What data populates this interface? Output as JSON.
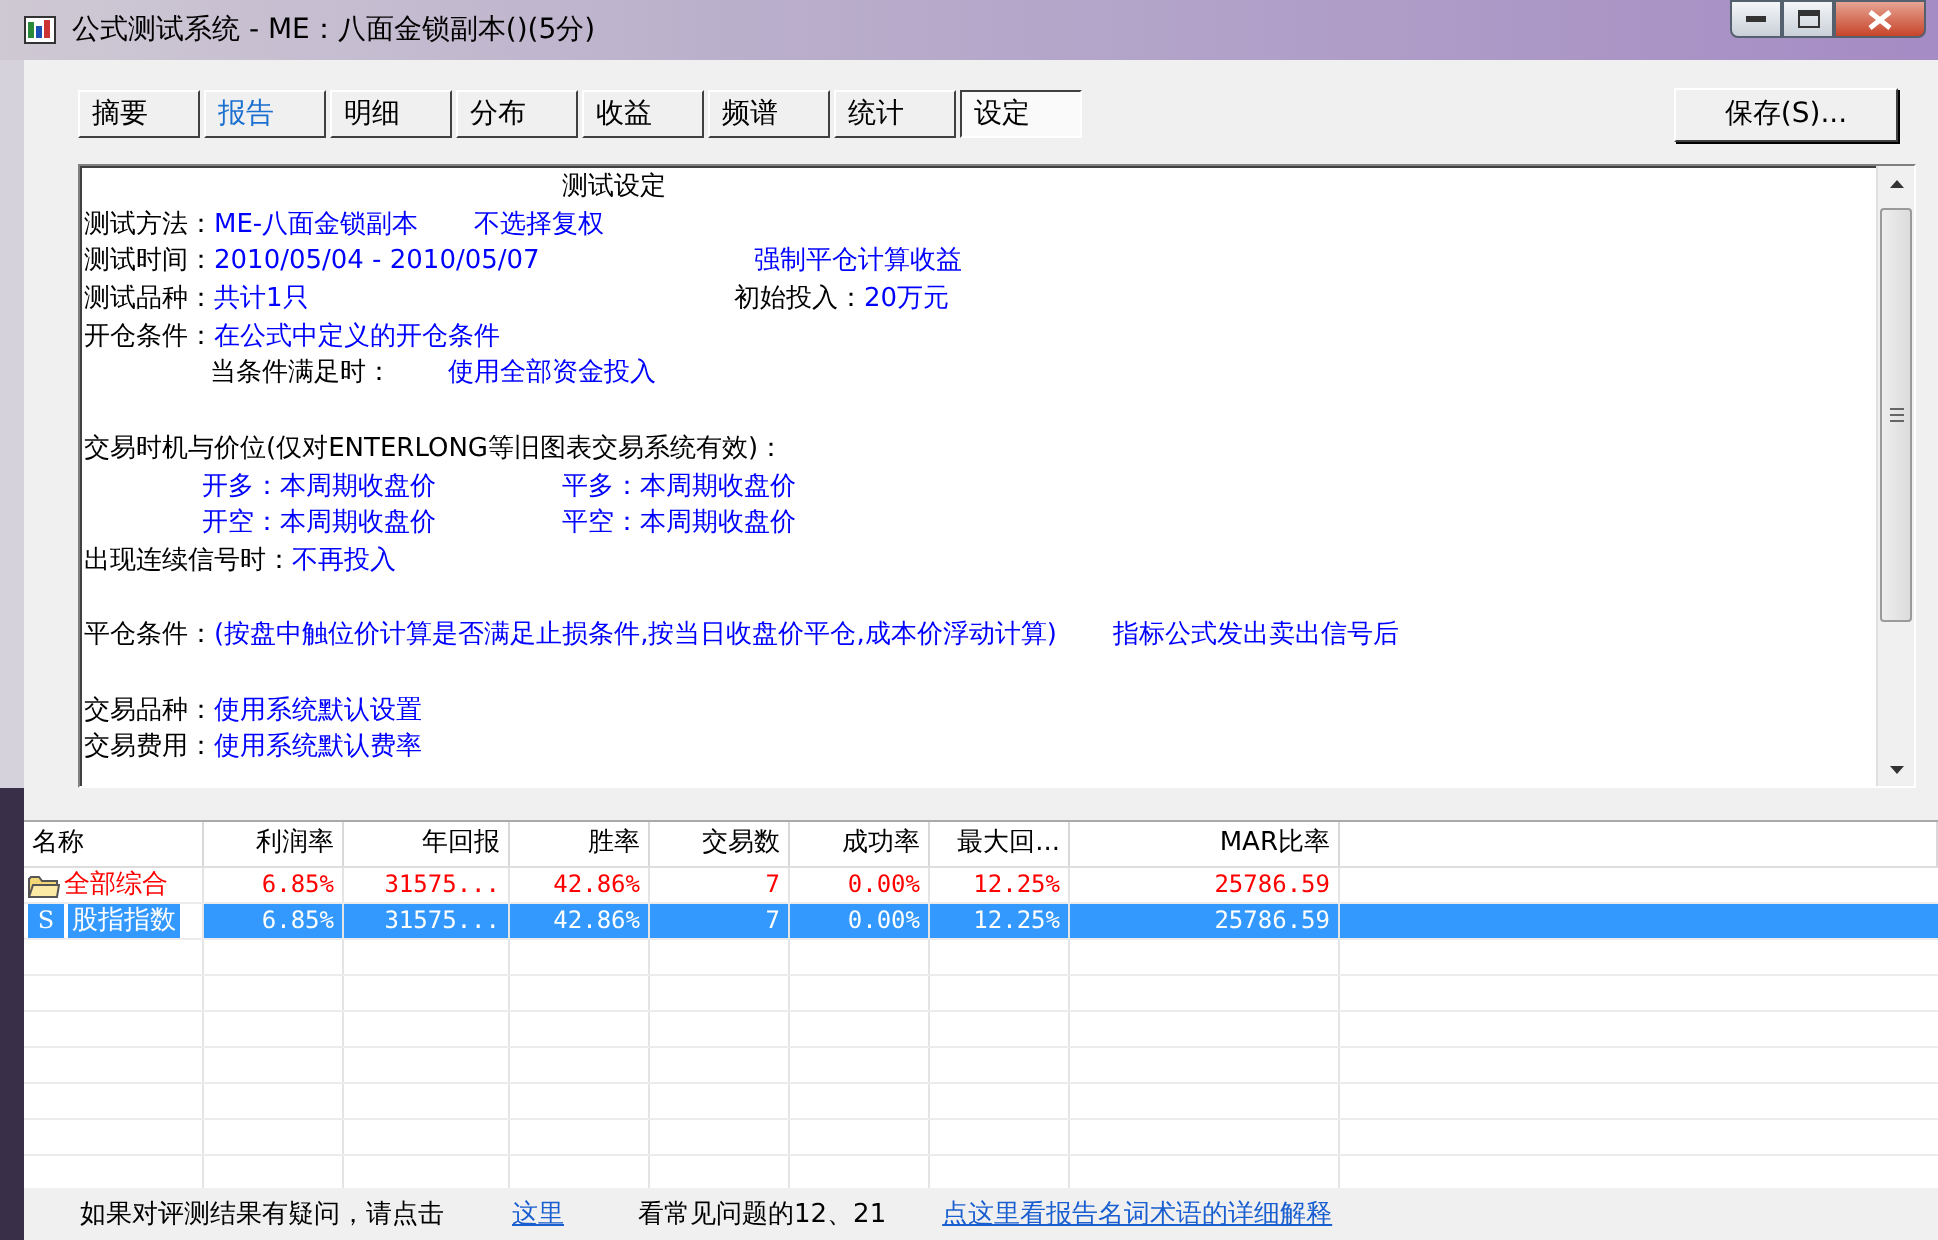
{
  "window": {
    "title": "公式测试系统 - ME：八面金锁副本()(5分)"
  },
  "tabs": [
    {
      "label": "摘要",
      "selected": false,
      "hot": false
    },
    {
      "label": "报告",
      "selected": false,
      "hot": true
    },
    {
      "label": "明细",
      "selected": false,
      "hot": false
    },
    {
      "label": "分布",
      "selected": false,
      "hot": false
    },
    {
      "label": "收益",
      "selected": false,
      "hot": false
    },
    {
      "label": "频谱",
      "selected": false,
      "hot": false
    },
    {
      "label": "统计",
      "selected": false,
      "hot": false
    },
    {
      "label": "设定",
      "selected": true,
      "hot": false
    }
  ],
  "save_button": "保存(S)...",
  "report": {
    "lines": [
      {
        "kind": "heading",
        "text": "测试设定"
      },
      {
        "kind": "field",
        "label": "测试方法：",
        "value": "ME-八面金锁副本",
        "extra": "不选择复权"
      },
      {
        "kind": "field",
        "label": "测试时间：",
        "value": "2010/05/04 - 2010/05/07",
        "aside_value": "强制平仓计算收益"
      },
      {
        "kind": "field",
        "label": "测试品种：",
        "value": "共计1只",
        "aside_label": "初始投入：",
        "aside_value": "20万元"
      },
      {
        "kind": "field",
        "label": "开仓条件：",
        "value": "在公式中定义的开仓条件"
      },
      {
        "kind": "sub",
        "label": "当条件满足时：",
        "value": "使用全部资金投入"
      },
      {
        "kind": "blank"
      },
      {
        "kind": "text",
        "text": "交易时机与价位(仅对ENTERLONG等旧图表交易系统有效)："
      },
      {
        "kind": "prices",
        "items": [
          "开多：本周期收盘价",
          "平多：本周期收盘价"
        ]
      },
      {
        "kind": "prices",
        "items": [
          "开空：本周期收盘价",
          "平空：本周期收盘价"
        ]
      },
      {
        "kind": "field",
        "label": "出现连续信号时：",
        "value": "不再投入"
      },
      {
        "kind": "blank"
      },
      {
        "kind": "field",
        "label": "平仓条件：",
        "value": "(按盘中触位价计算是否满足止损条件,按当日收盘价平仓,成本价浮动计算)",
        "extra": "指标公式发出卖出信号后"
      },
      {
        "kind": "blank"
      },
      {
        "kind": "field",
        "label": "交易品种：",
        "value": "使用系统默认设置"
      },
      {
        "kind": "field",
        "label": "交易费用：",
        "value": "使用系统默认费率"
      }
    ]
  },
  "table": {
    "columns": [
      "名称",
      "利润率",
      "年回报",
      "胜率",
      "交易数",
      "成功率",
      "最大回...",
      "MAR比率"
    ],
    "rows": [
      {
        "kind": "group",
        "selected": false,
        "cells": [
          "全部综合",
          "6.85%",
          "31575...",
          "42.86%",
          "7",
          "0.00%",
          "12.25%",
          "25786.59"
        ]
      },
      {
        "kind": "item",
        "selected": true,
        "icon_letter": "S",
        "cells": [
          "股指指数",
          "6.85%",
          "31575...",
          "42.86%",
          "7",
          "0.00%",
          "12.25%",
          "25786.59"
        ]
      }
    ]
  },
  "footer": {
    "text": "如果对评测结果有疑问，请点击",
    "link": "这里",
    "note": "看常见问题的12、21",
    "help_link": "点这里看报告名词术语的详细解释"
  }
}
